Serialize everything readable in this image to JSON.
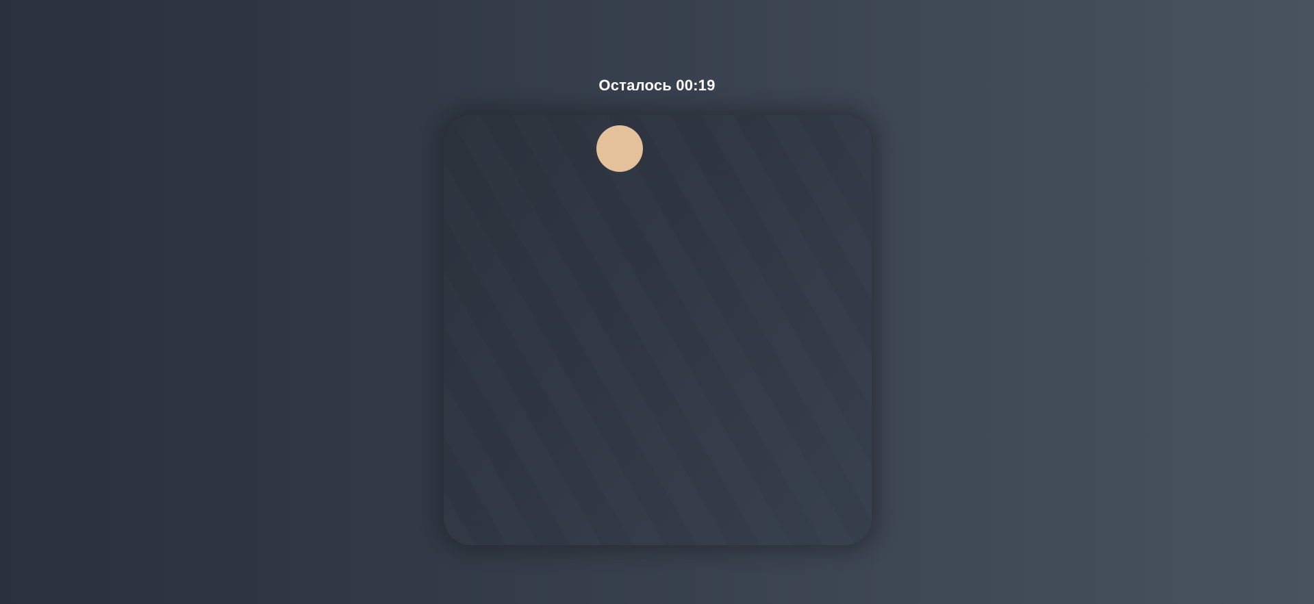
{
  "game": {
    "timer_text": "Осталось 00:19",
    "time_remaining_seconds": 19
  },
  "target": {
    "color": "#e4c09b"
  },
  "colors": {
    "text": "#ffffff",
    "arena": "#2f3641"
  }
}
